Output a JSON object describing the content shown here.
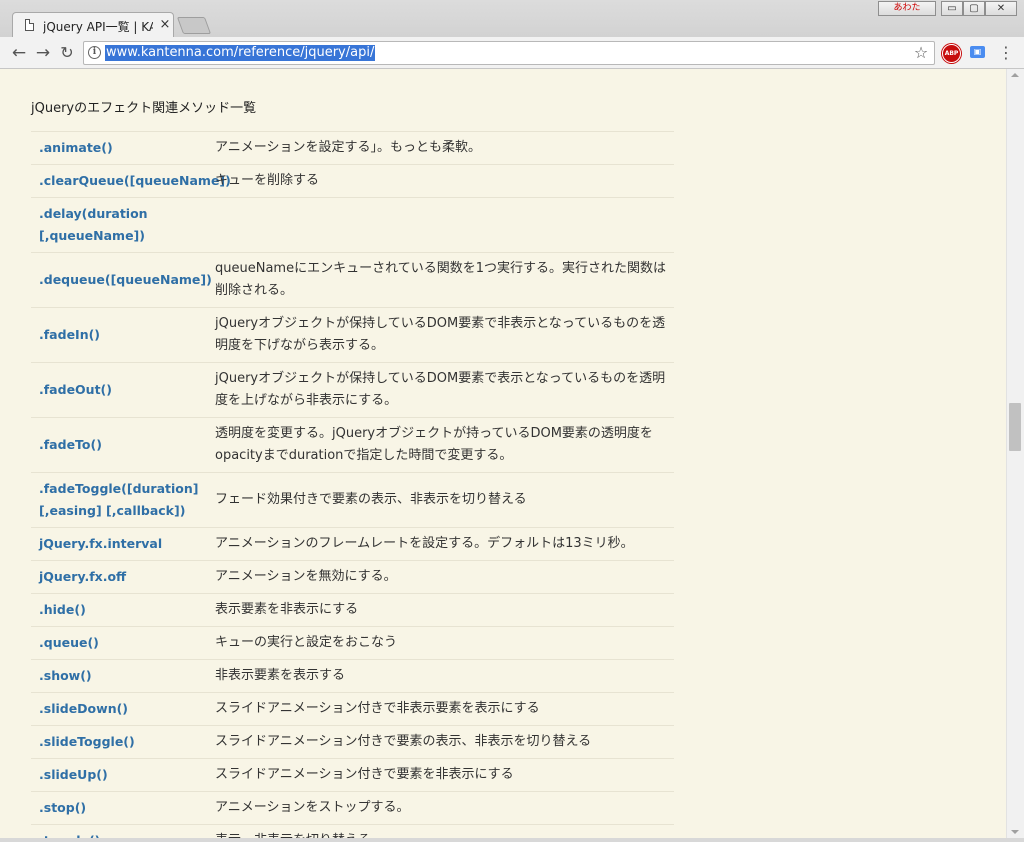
{
  "tab": {
    "title": "jQuery API一覧 | KANTENNA",
    "close": "×"
  },
  "window": {
    "profile": "あわた",
    "minimize": "▭",
    "maximize": "▢",
    "close": "✕"
  },
  "toolbar": {
    "back": "←",
    "forward": "→",
    "reload": "↻",
    "info": "i",
    "url": "www.kantenna.com/reference/jquery/api/",
    "star": "☆",
    "abp": "ABP",
    "ext": "▣",
    "menu": "⋮"
  },
  "content": {
    "heading": "jQueryのエフェクト関連メソッド一覧",
    "methods": [
      {
        "name": ".animate()",
        "desc": "アニメーションを設定する」。もっとも柔軟。"
      },
      {
        "name": ".clearQueue([queueName])",
        "desc": "キューを削除する"
      },
      {
        "name": ".delay(duration [,queueName])",
        "desc": ""
      },
      {
        "name": ".dequeue([queueName])",
        "desc": "queueNameにエンキューされている関数を1つ実行する。実行された関数は削除される。"
      },
      {
        "name": ".fadeIn()",
        "desc": "jQueryオブジェクトが保持しているDOM要素で非表示となっているものを透明度を下げながら表示する。"
      },
      {
        "name": ".fadeOut()",
        "desc": "jQueryオブジェクトが保持しているDOM要素で表示となっているものを透明度を上げながら非表示にする。"
      },
      {
        "name": ".fadeTo()",
        "desc": "透明度を変更する。jQueryオブジェクトが持っているDOM要素の透明度をopacityまでdurationで指定した時間で変更する。"
      },
      {
        "name": ".fadeToggle([duration] [,easing] [,callback])",
        "desc": "フェード効果付きで要素の表示、非表示を切り替える"
      },
      {
        "name": "jQuery.fx.interval",
        "desc": "アニメーションのフレームレートを設定する。デフォルトは13ミリ秒。"
      },
      {
        "name": "jQuery.fx.off",
        "desc": "アニメーションを無効にする。"
      },
      {
        "name": ".hide()",
        "desc": "表示要素を非表示にする"
      },
      {
        "name": ".queue()",
        "desc": "キューの実行と設定をおこなう"
      },
      {
        "name": ".show()",
        "desc": "非表示要素を表示する"
      },
      {
        "name": ".slideDown()",
        "desc": "スライドアニメーション付きで非表示要素を表示にする"
      },
      {
        "name": ".slideToggle()",
        "desc": "スライドアニメーション付きで要素の表示、非表示を切り替える"
      },
      {
        "name": ".slideUp()",
        "desc": "スライドアニメーション付きで要素を非表示にする"
      },
      {
        "name": ".stop()",
        "desc": "アニメーションをストップする。"
      },
      {
        "name": ".toggle()",
        "desc": "表示、非表示を切り替える。"
      }
    ]
  }
}
